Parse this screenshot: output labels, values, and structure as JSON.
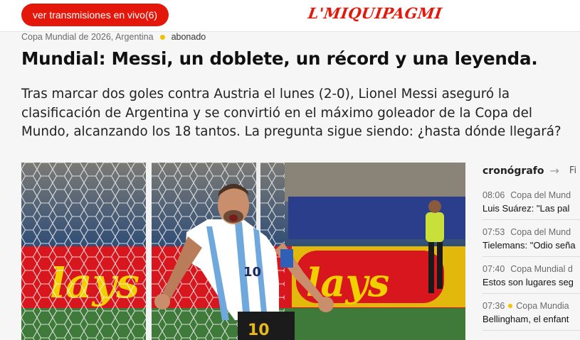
{
  "header": {
    "live_button": "ver transmisiones en vivo(6)",
    "logo": "L'MIQUIPAGMI"
  },
  "article": {
    "section": "Copa Mundial de 2026, Argentina",
    "badge": "abonado",
    "headline": "Mundial: Messi, un doblete, un récord y una leyenda.",
    "lead": "Tras marcar dos goles contra Austria el lunes (2-0), Lionel Messi aseguró la clasificación de Argentina y se convirtió en el máximo goleador de la Copa del Mundo, alcanzando los 18 tantos. La pregunta sigue siendo: ¿hasta dónde llegará?",
    "photo": {
      "ad_board_text": "lays",
      "jersey_number": "10"
    }
  },
  "sidebar": {
    "title": "cronógrafo",
    "extra": "Fi",
    "items": [
      {
        "time": "08:06",
        "section": "Copa del Mund",
        "title": "Luis Suárez: \"Las pal",
        "dot": false
      },
      {
        "time": "07:53",
        "section": "Copa del Mund",
        "title": "Tielemans: \"Odio seña",
        "dot": false
      },
      {
        "time": "07:40",
        "section": "Copa Mundial d",
        "title": "Estos son lugares seg",
        "dot": false
      },
      {
        "time": "07:36",
        "section": "Copa Mundia",
        "title": "Bellingham, el enfant",
        "dot": true
      }
    ]
  },
  "colors": {
    "brand": "#e3170a",
    "subscriber_dot": "#f2c200"
  }
}
